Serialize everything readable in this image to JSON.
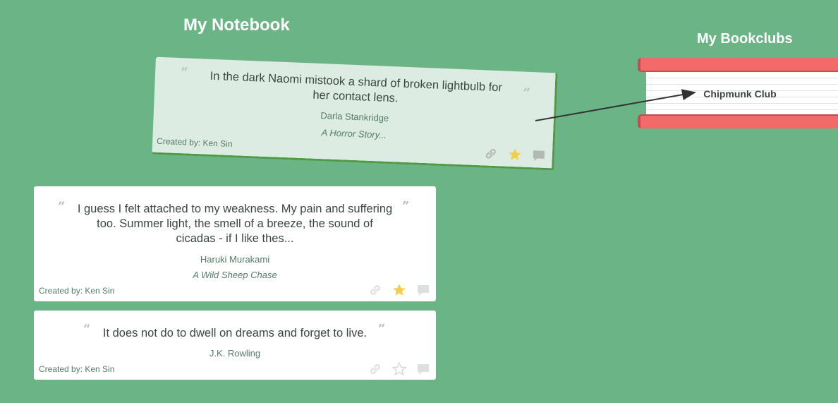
{
  "notebook": {
    "title": "My Notebook"
  },
  "bookclubs": {
    "title": "My Bookclubs",
    "items": [
      {
        "name": "Chipmunk Club"
      }
    ]
  },
  "quotes": [
    {
      "text": "In the dark Naomi mistook a shard of broken lightbulb for her contact lens.",
      "author": "Darla Stankridge",
      "book": "A Horror Story...",
      "created_by": "Created by: Ken Sin",
      "favorited": true,
      "dragging": true
    },
    {
      "text": "I guess I felt attached to my weakness. My pain and suffering too. Summer light, the smell of a breeze, the sound of cicadas - if I like thes...",
      "author": "Haruki Murakami",
      "book": "A Wild Sheep Chase",
      "created_by": "Created by: Ken Sin",
      "favorited": true,
      "dragging": false
    },
    {
      "text": "It does not do to dwell on dreams and forget to live.",
      "author": "J.K. Rowling",
      "book": "",
      "created_by": "Created by: Ken Sin",
      "favorited": false,
      "dragging": false
    }
  ],
  "icons": {
    "link": "link-icon",
    "star": "star-icon",
    "comment": "comment-icon",
    "open_quote": "open-quote-icon",
    "close_quote": "close-quote-icon"
  },
  "colors": {
    "background": "#6bb485",
    "star_active": "#f3cd45",
    "star_inactive": "#d7dbd8",
    "bookclub_cover": "#f26a6a",
    "card_dragging": "#dcece2"
  }
}
